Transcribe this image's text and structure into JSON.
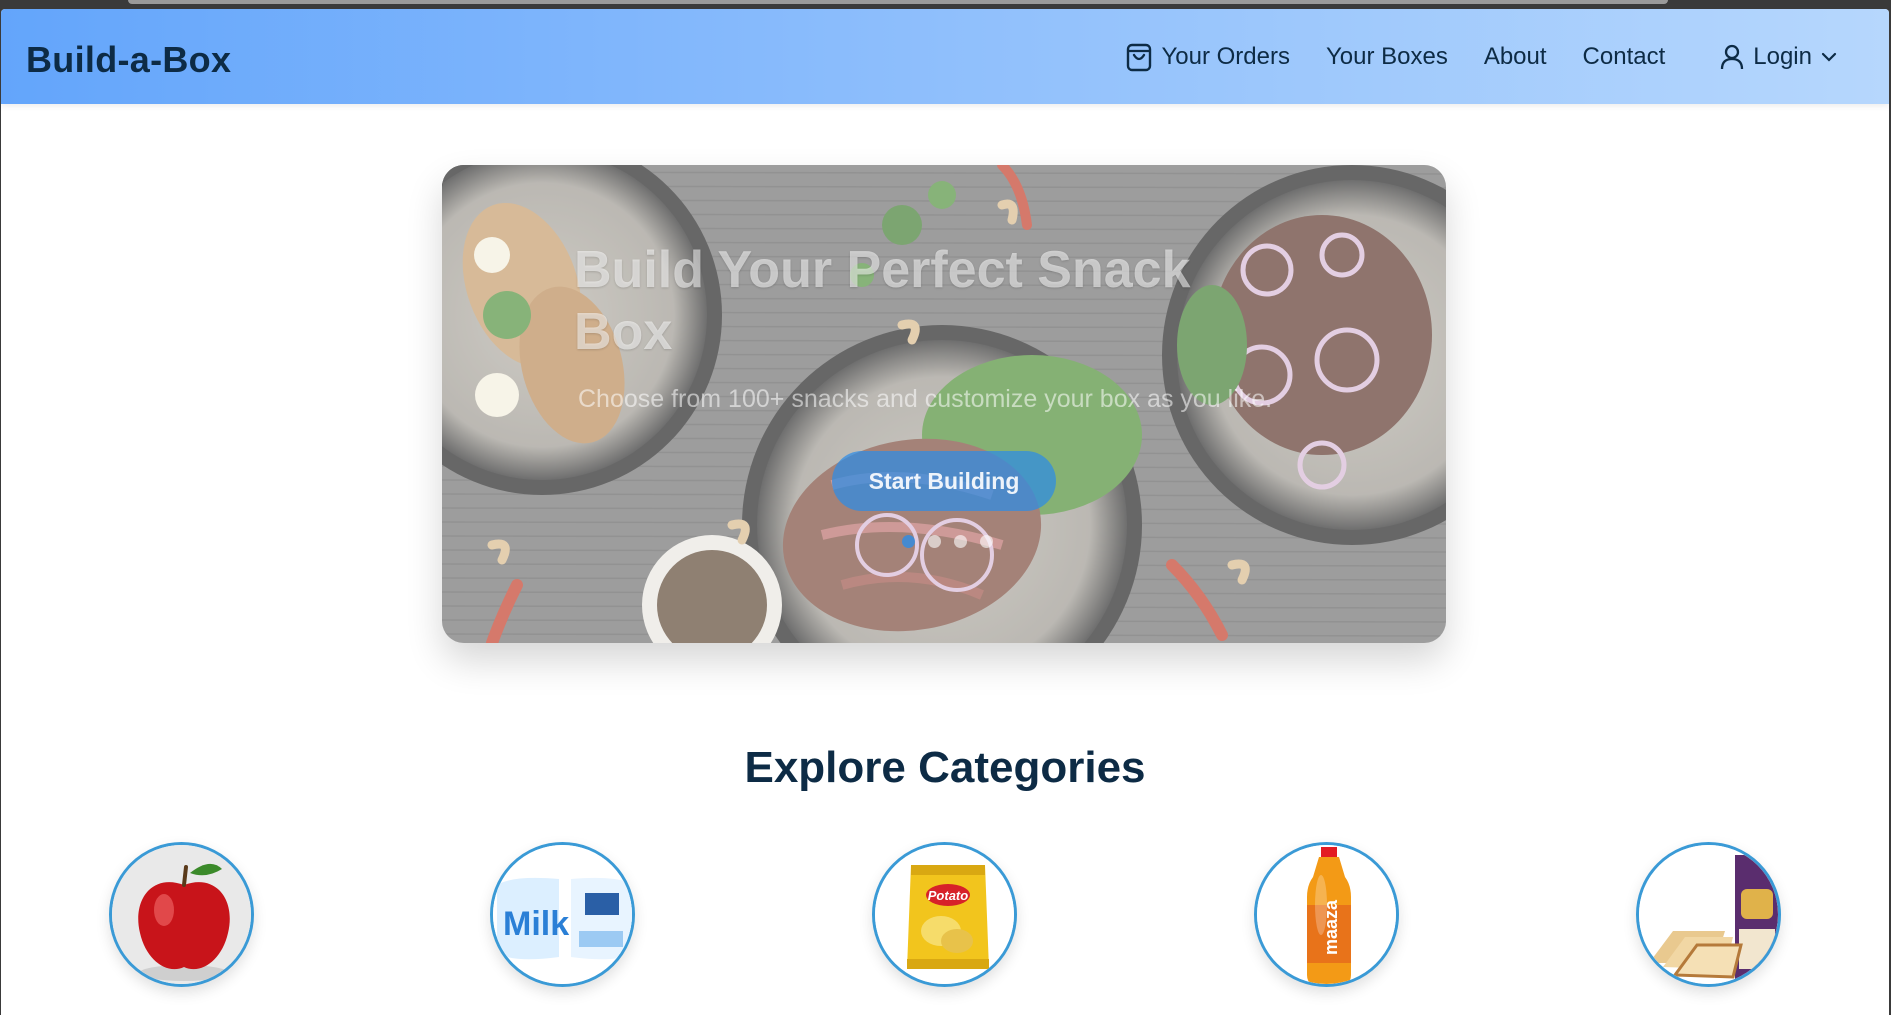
{
  "navbar": {
    "brand": "Build-a-Box",
    "links": [
      {
        "label": "Your Orders",
        "icon": "shopping-bag-icon"
      },
      {
        "label": "Your Boxes"
      },
      {
        "label": "About"
      },
      {
        "label": "Contact"
      }
    ],
    "login": {
      "label": "Login",
      "icon": "user-icon",
      "caret": "chevron-down-icon"
    }
  },
  "hero": {
    "title": "Build Your Perfect Snack Box",
    "subtitle": "Choose from 100+ snacks and customize your box as you like.",
    "cta": "Start Building",
    "slides": 4,
    "active_slide": 1
  },
  "categories": {
    "title": "Explore Categories",
    "items": [
      {
        "icon": "apple-icon"
      },
      {
        "icon": "milk-packet-icon",
        "label_on_pack": "Milk"
      },
      {
        "icon": "potato-chips-icon",
        "label_on_pack": "Potato"
      },
      {
        "icon": "maaza-bottle-icon",
        "label_on_pack": "maaza"
      },
      {
        "icon": "bread-and-atta-icon"
      }
    ]
  },
  "colors": {
    "navbar_start": "#63a5fb",
    "navbar_end": "#b6d7fd",
    "text_dark": "#0d2b45",
    "accent_blue": "#3a9ad6",
    "cta_blue": "#2d8ce6"
  }
}
